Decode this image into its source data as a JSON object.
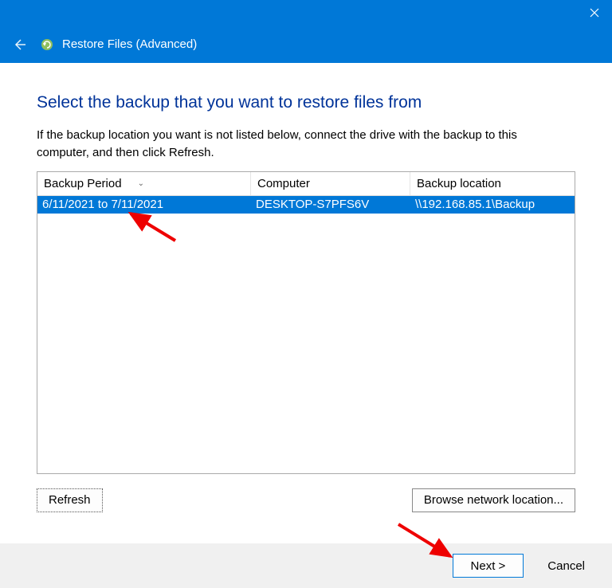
{
  "window": {
    "title": "Restore Files (Advanced)"
  },
  "page": {
    "heading": "Select the backup that you want to restore files from",
    "instruction": "If the backup location you want is not listed below, connect the drive with the backup to this computer, and then click Refresh."
  },
  "columns": {
    "period": "Backup Period",
    "computer": "Computer",
    "location": "Backup location"
  },
  "backups": [
    {
      "period": "6/11/2021 to 7/11/2021",
      "computer": "DESKTOP-S7PFS6V",
      "location": "\\\\192.168.85.1\\Backup",
      "selected": true
    }
  ],
  "buttons": {
    "refresh": "Refresh",
    "browse": "Browse network location...",
    "next": "Next >",
    "cancel": "Cancel"
  }
}
